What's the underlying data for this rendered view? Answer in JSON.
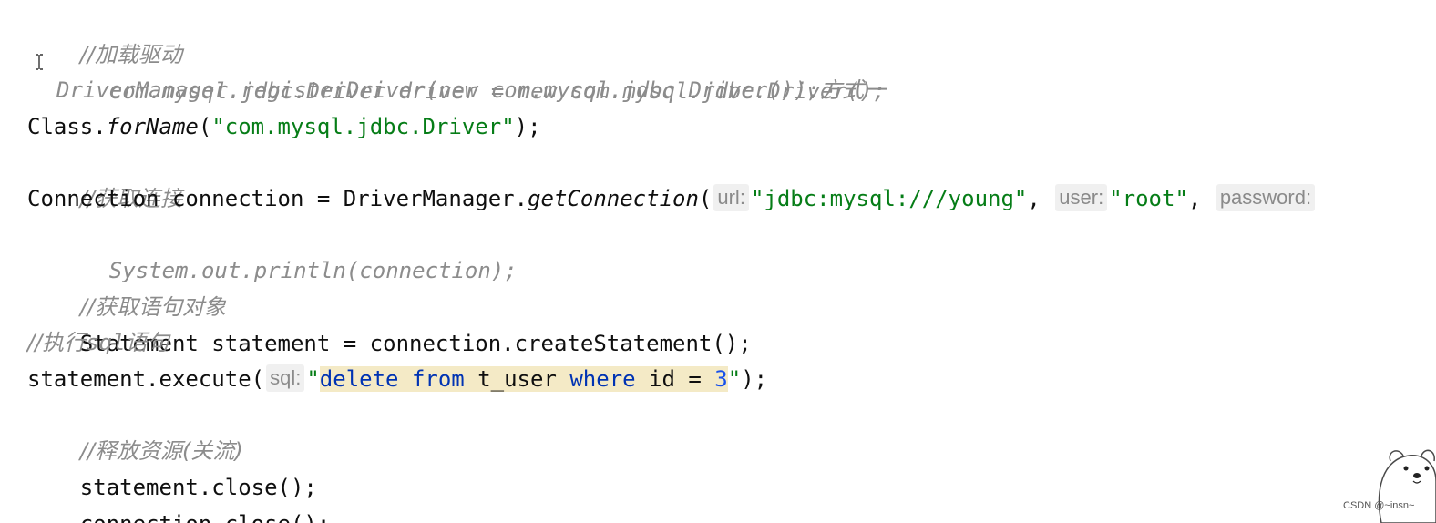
{
  "code": {
    "line1_comment": "//加载驱动",
    "line2_comment_code": "com.mysql.jdbc.Driver driver = new com.mysql.jdbc.Driver();",
    "line3_comment_code": "DriverManager.registerDriver(new com.mysql.jdbc.Driver());",
    "line3_comment_suffix": "方式一",
    "line4_class": "Class.",
    "line4_method": "forName",
    "line4_open": "(",
    "line4_string": "\"com.mysql.jdbc.Driver\"",
    "line4_close": ");",
    "line5_comment": "//获取连接",
    "line6_prefix": "Connection connection = DriverManager.",
    "line6_method": "getConnection",
    "line6_open": "(",
    "line6_hint_url": "url:",
    "line6_url_string": "\"jdbc:mysql:///young\"",
    "line6_sep1": ", ",
    "line6_hint_user": "user:",
    "line6_user_string": "\"root\"",
    "line6_sep2": ", ",
    "line6_hint_password": "password:",
    "line7_comment_code": "System.out.println(connection);",
    "line8_comment": "//获取语句对象",
    "line9_code": "Statement statement = connection.createStatement();",
    "line10_comment_prefix": "//执行",
    "line10_comment_sql": "sql",
    "line10_comment_suffix": "语句",
    "line11_prefix": "statement.execute(",
    "line11_hint_sql": "sql:",
    "line11_quote_open": "\"",
    "line11_kw_delete": "delete",
    "line11_sp1": " ",
    "line11_kw_from": "from",
    "line11_table": " t_user ",
    "line11_kw_where": "where",
    "line11_cond": " id = ",
    "line11_num": "3",
    "line11_quote_close": "\"",
    "line11_end": ");",
    "line12_comment": "//释放资源(关流)",
    "line13_code": "statement.close();",
    "line14_code": "connection.close();"
  },
  "watermark": "CSDN @~insn~",
  "icons": {
    "cursor": "text-cursor-icon",
    "mascot": "polar-bear-mascot-icon"
  },
  "colors": {
    "comment": "#8c8c8c",
    "string": "#067d17",
    "keyword": "#0033b3",
    "number": "#1750eb",
    "highlight": "#f4eac6",
    "hint_bg": "#f0f0f0"
  }
}
